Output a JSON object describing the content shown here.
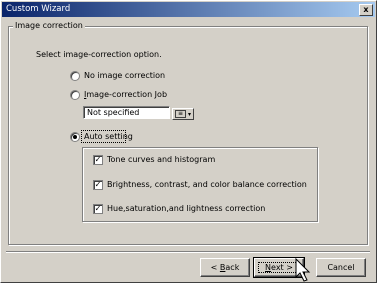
{
  "window": {
    "title": "Custom Wizard",
    "close_symbol": "x"
  },
  "group": {
    "label": "Image correction",
    "instruction": "Select image-correction option."
  },
  "options": {
    "none_label": "No image correction",
    "job_label_prefix": "",
    "job_label_mnemonic": "I",
    "job_label_rest": "mage-correction Job",
    "job_value": "Not specified",
    "auto_label": "Auto setting",
    "selected": "Auto setting"
  },
  "auto_checks": [
    {
      "label": "Tone curves and histogram",
      "checked": true
    },
    {
      "label": "Brightness, contrast, and color balance correction",
      "checked": true
    },
    {
      "label": "Hue,saturation,and lightness correction",
      "checked": true
    }
  ],
  "buttons": {
    "back_prefix": "< ",
    "back_mnemonic": "B",
    "back_rest": "ack",
    "next_mnemonic": "N",
    "next_rest": "ext >",
    "cancel": "Cancel"
  },
  "check_mark": "✓",
  "dropdown_arrow": "▾",
  "dropdown_box_glyph": "≡"
}
